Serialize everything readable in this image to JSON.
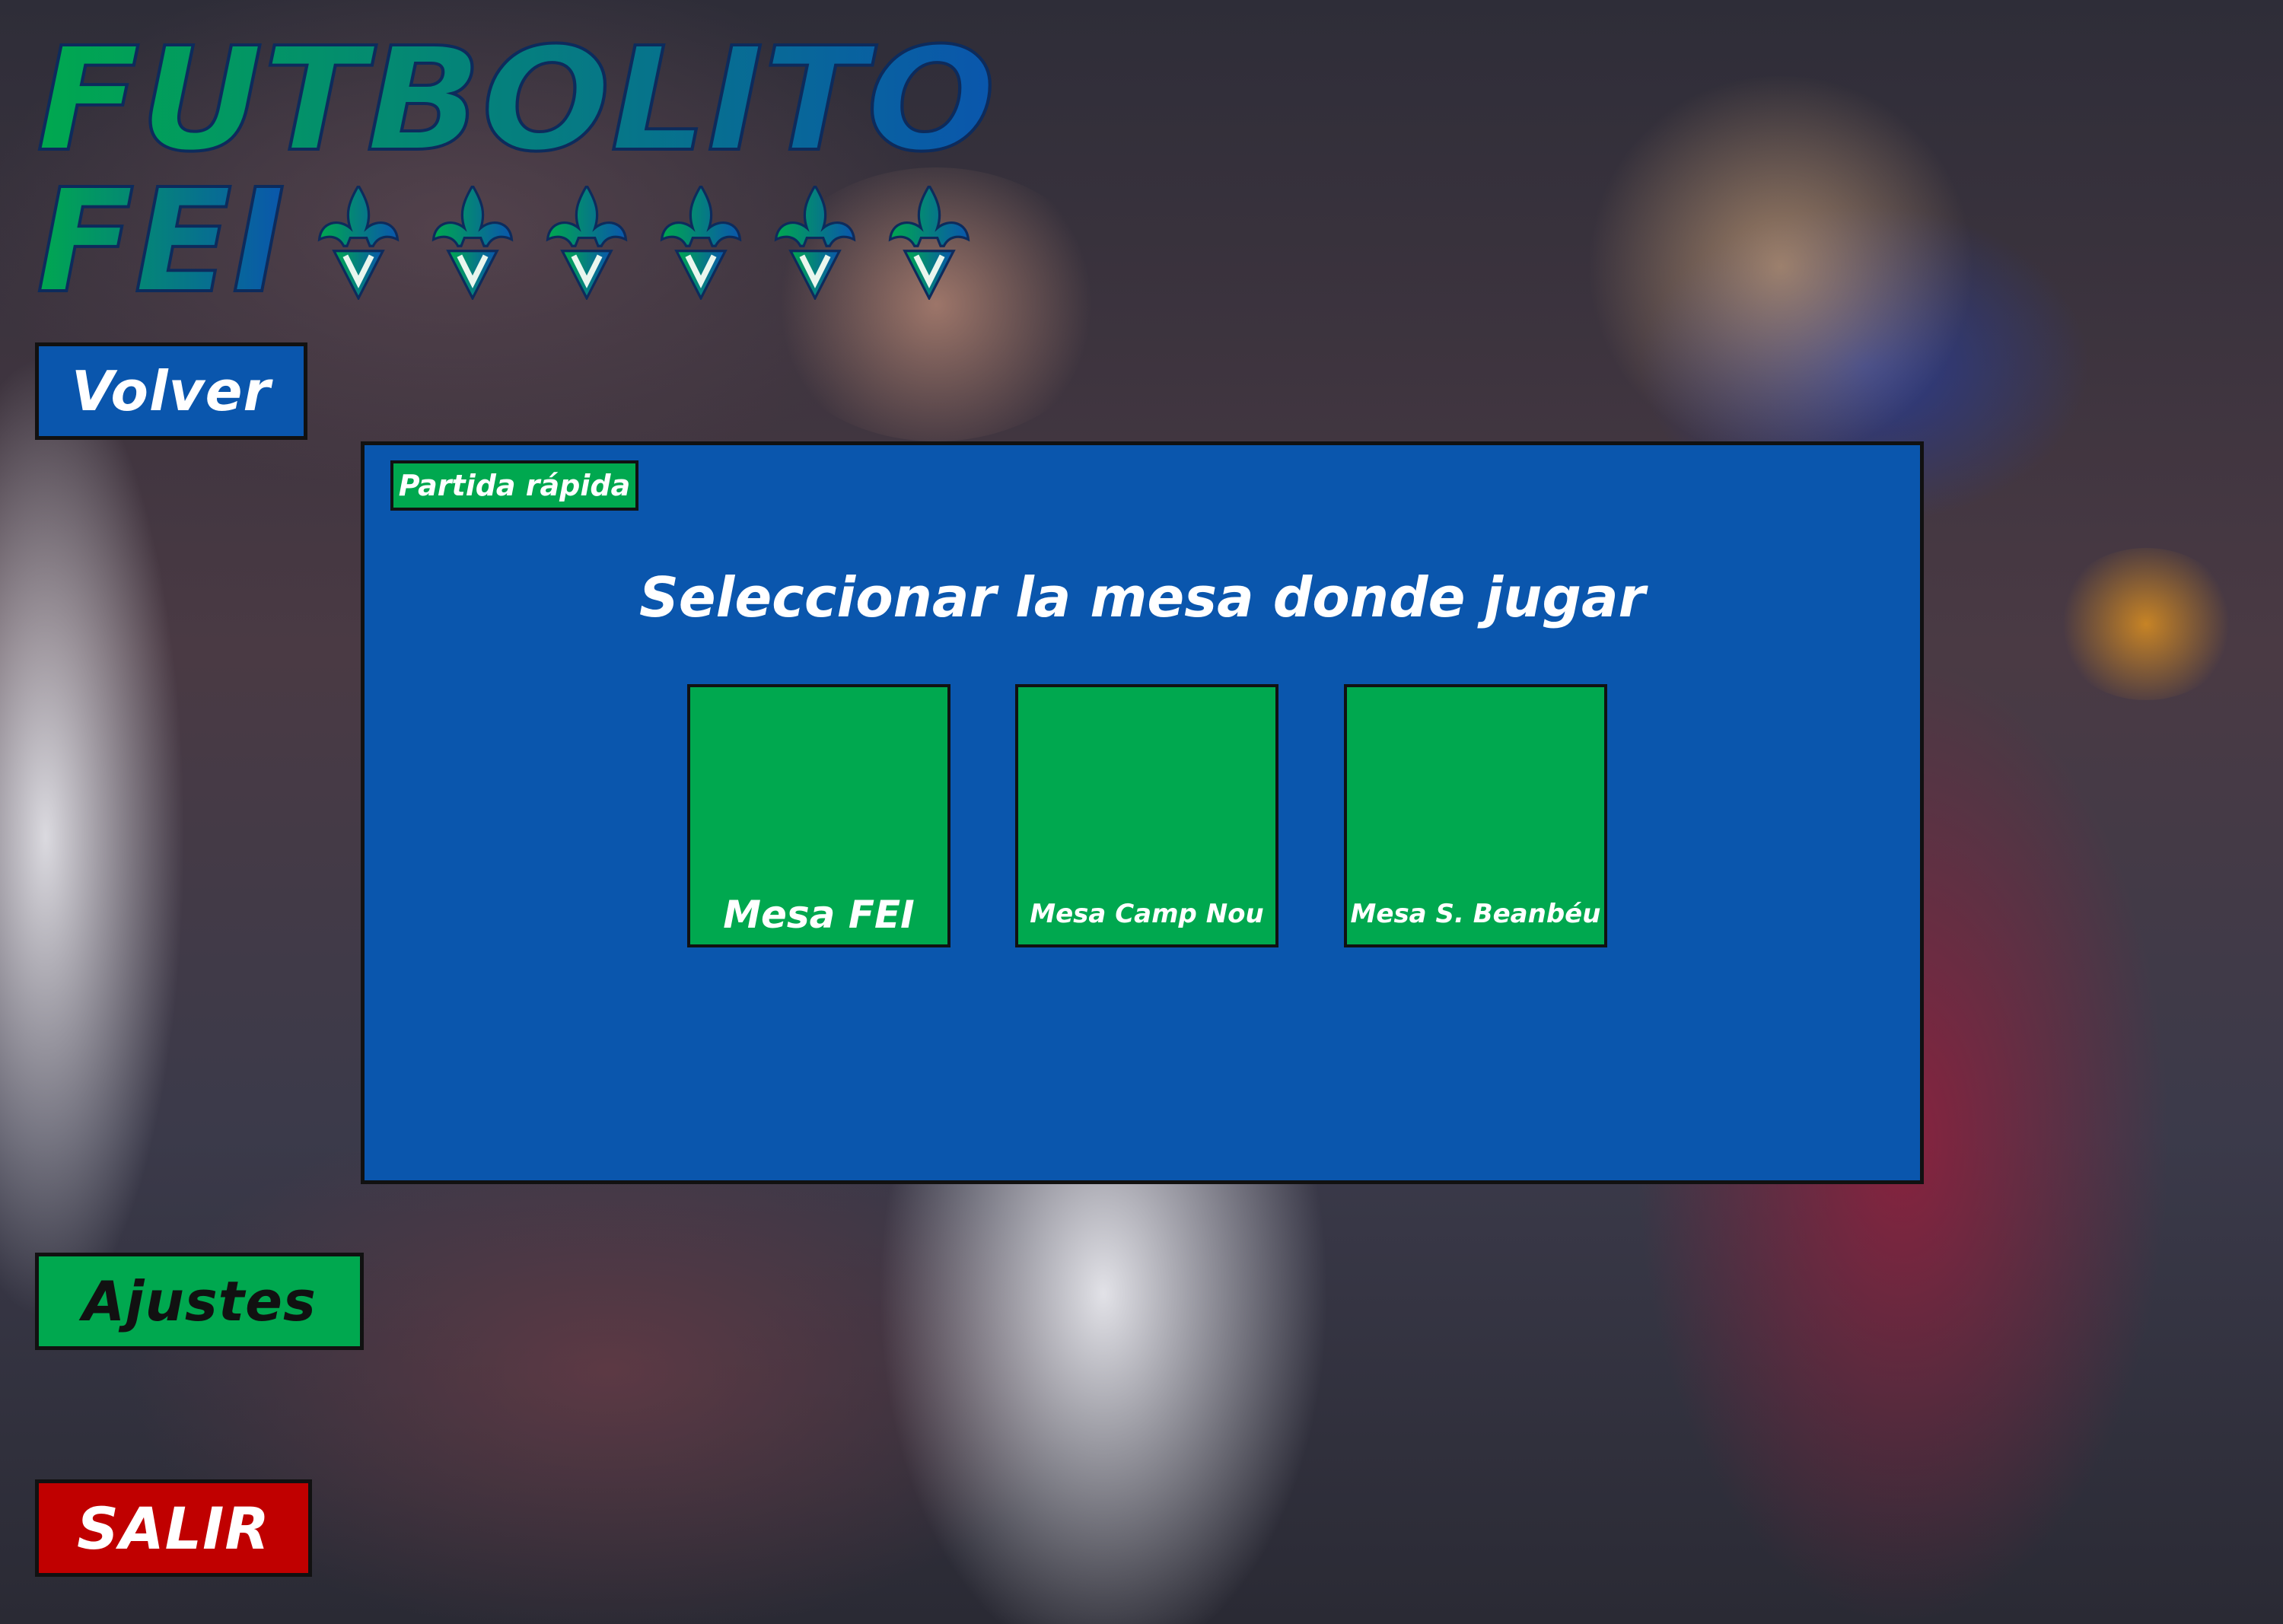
{
  "logo": {
    "line1": "FUTBOLITO",
    "line2": "FEI",
    "emblem_icon": "fleur-de-lis-v-icon",
    "emblem_count": 6,
    "gradient_colors": [
      "#00a84f",
      "#0a56ad"
    ]
  },
  "buttons": {
    "volver": "Volver",
    "ajustes": "Ajustes",
    "salir": "SALIR"
  },
  "panel": {
    "tag": "Partida rápida",
    "title": "Seleccionar la mesa donde jugar",
    "mesas": [
      {
        "label": "Mesa FEI"
      },
      {
        "label": "Mesa Camp Nou"
      },
      {
        "label": "Mesa S. Beanbéu"
      }
    ]
  },
  "colors": {
    "blue": "#0a56ad",
    "green": "#00a84f",
    "red": "#c00000",
    "border": "#111111"
  }
}
